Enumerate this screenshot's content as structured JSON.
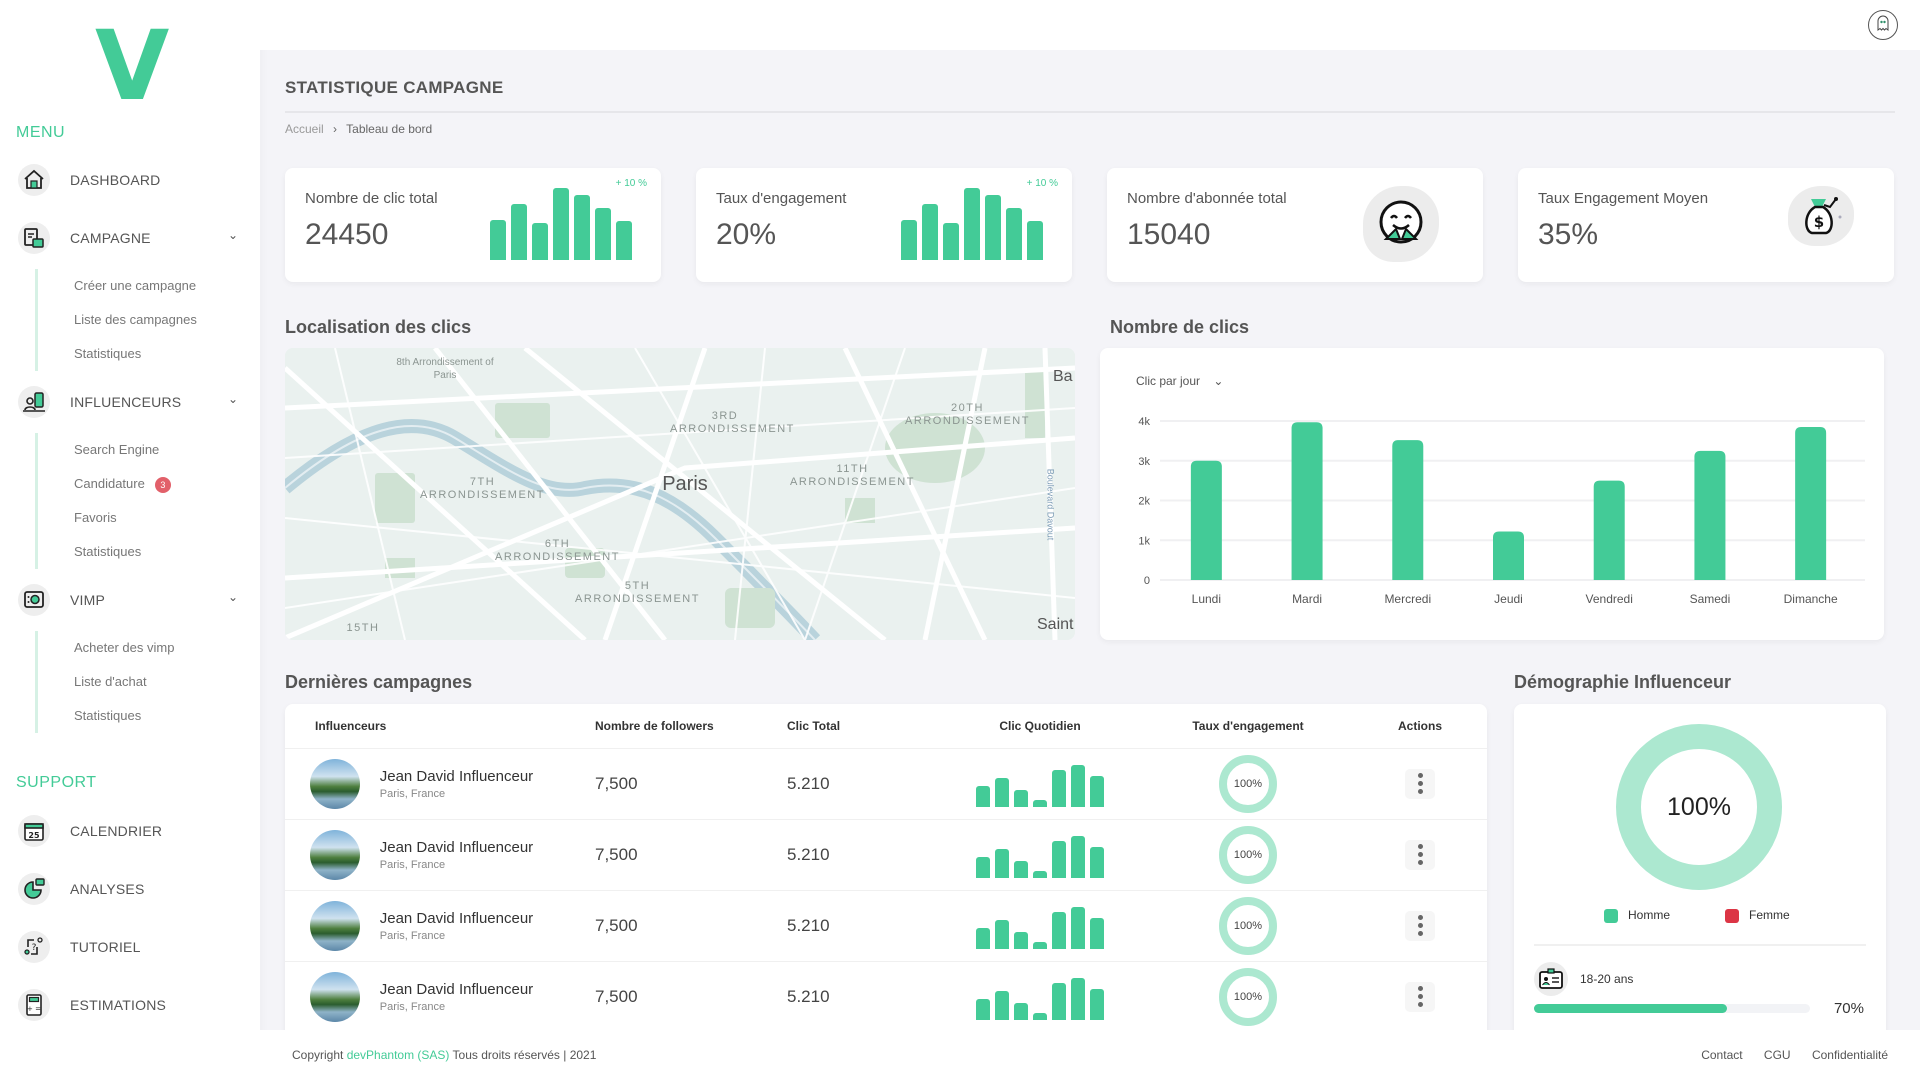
{
  "brand": {
    "logo": "V",
    "accent": "#43cb97"
  },
  "sidebar": {
    "menu_label": "MENU",
    "support_label": "SUPPORT",
    "items": [
      {
        "label": "DASHBOARD",
        "icon": "home-icon"
      },
      {
        "label": "CAMPAGNE",
        "icon": "campaign-icon",
        "sub": [
          "Créer une campagne",
          "Liste des campagnes",
          "Statistiques"
        ]
      },
      {
        "label": "INFLUENCEURS",
        "icon": "influencer-icon",
        "sub": [
          "Search Engine",
          "Candidature",
          "Favoris",
          "Statistiques"
        ],
        "badge": "3"
      },
      {
        "label": "VIMP",
        "icon": "vimp-icon",
        "sub": [
          "Acheter des vimp",
          "Liste d'achat",
          "Statistiques"
        ]
      }
    ],
    "support": [
      {
        "label": "CALENDRIER",
        "icon": "calendar-icon",
        "day": "25"
      },
      {
        "label": "ANALYSES",
        "icon": "analytics-icon"
      },
      {
        "label": "TUTORIEL",
        "icon": "tutorial-icon"
      },
      {
        "label": "ESTIMATIONS",
        "icon": "calculator-icon"
      }
    ]
  },
  "header": {
    "title": "STATISTIQUE CAMPAGNE",
    "breadcrumb": [
      "Accueil",
      "Tableau de bord"
    ],
    "separator": "›"
  },
  "stats": [
    {
      "title": "Nombre de clic total",
      "value": "24450",
      "delta": "+ 10 %",
      "bars": [
        0.55,
        0.78,
        0.52,
        1.0,
        0.9,
        0.72,
        0.54
      ]
    },
    {
      "title": "Taux d'engagement",
      "value": "20%",
      "delta": "+ 10 %",
      "bars": [
        0.55,
        0.78,
        0.52,
        1.0,
        0.9,
        0.72,
        0.54
      ]
    },
    {
      "title": "Nombre d'abonnée total",
      "value": "15040",
      "icon": "hug-emoji-icon"
    },
    {
      "title": "Taux Engagement Moyen",
      "value": "35%",
      "icon": "money-bag-icon"
    }
  ],
  "map": {
    "title": "Localisation des clics",
    "labels": [
      "8th Arrondissement of Paris",
      "3RD ARRONDISSEMENT",
      "20TH ARRONDISSEMENT",
      "7TH ARRONDISSEMENT",
      "Paris",
      "11TH ARRONDISSEMENT",
      "6TH ARRONDISSEMENT",
      "5TH ARRONDISSEMENT",
      "15TH",
      "Ba",
      "Saint",
      "Boulevard Davout"
    ]
  },
  "clicks": {
    "title": "Nombre de clics",
    "selector": "Clic par jour",
    "chart_data": {
      "type": "bar",
      "title": "Nombre de clics",
      "xlabel": "",
      "ylabel": "",
      "categories": [
        "Lundi",
        "Mardi",
        "Mercredi",
        "Jeudi",
        "Vendredi",
        "Samedi",
        "Dimanche"
      ],
      "values": [
        3000,
        3970,
        3520,
        1220,
        2500,
        3250,
        3850
      ],
      "yticks": [
        "0",
        "1k",
        "2k",
        "3k",
        "4k"
      ],
      "ylim": [
        0,
        4000
      ],
      "grid": true
    }
  },
  "campaigns": {
    "title": "Dernières campagnes",
    "columns": [
      "Influenceurs",
      "Nombre de followers",
      "Clic Total",
      "Clic Quotidien",
      "Taux d'engagement",
      "Actions"
    ],
    "rows": [
      {
        "name": "Jean David Influenceur",
        "location": "Paris, France",
        "followers": "7,500",
        "clicks": "5.210",
        "daily": [
          0.45,
          0.62,
          0.36,
          0.16,
          0.8,
          0.92,
          0.67
        ],
        "rate": "100%"
      },
      {
        "name": "Jean David Influenceur",
        "location": "Paris, France",
        "followers": "7,500",
        "clicks": "5.210",
        "daily": [
          0.45,
          0.62,
          0.36,
          0.16,
          0.8,
          0.92,
          0.67
        ],
        "rate": "100%"
      },
      {
        "name": "Jean David Influenceur",
        "location": "Paris, France",
        "followers": "7,500",
        "clicks": "5.210",
        "daily": [
          0.45,
          0.62,
          0.36,
          0.16,
          0.8,
          0.92,
          0.67
        ],
        "rate": "100%"
      },
      {
        "name": "Jean David Influenceur",
        "location": "Paris, France",
        "followers": "7,500",
        "clicks": "5.210",
        "daily": [
          0.45,
          0.62,
          0.36,
          0.16,
          0.8,
          0.92,
          0.67
        ],
        "rate": "100%"
      }
    ]
  },
  "demographics": {
    "title": "Démographie Influenceur",
    "center": "100%",
    "legend": [
      {
        "label": "Homme",
        "color": "#43cb97"
      },
      {
        "label": "Femme",
        "color": "#dc3545"
      }
    ],
    "age_group": {
      "label": "18-20 ans",
      "percent": 70,
      "display": "70%"
    }
  },
  "footer": {
    "prefix": "Copyright",
    "company": "devPhantom (SAS)",
    "suffix": "Tous droits réservés | 2021",
    "links": [
      "Contact",
      "CGU",
      "Confidentialité"
    ]
  }
}
